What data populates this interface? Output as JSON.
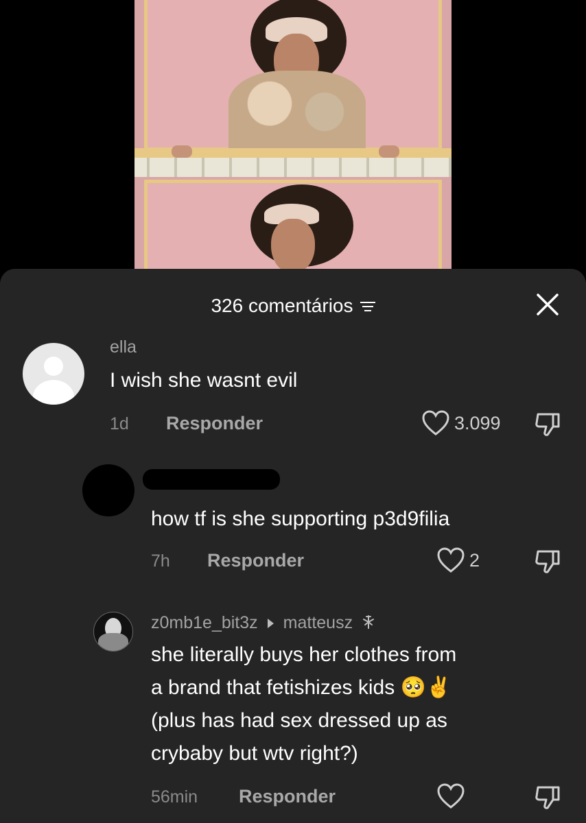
{
  "header": {
    "comment_count_label": "326 comentários"
  },
  "comments": [
    {
      "username": "ella",
      "text": "I wish she wasnt evil",
      "time": "1d",
      "reply_label": "Responder",
      "likes": "3.099"
    },
    {
      "username": "",
      "text": "how tf is she supporting p3d9filia",
      "time": "7h",
      "reply_label": "Responder",
      "likes": "2"
    },
    {
      "username": "z0mb1e_bit3z",
      "reply_to": "matteusz",
      "text_lines": [
        "she literally buys her clothes from",
        "a brand that fetishizes kids 🥺✌️",
        "(plus has had sex dressed up as",
        "crybaby but wtv right?)"
      ],
      "time": "56min",
      "reply_label": "Responder",
      "likes": ""
    }
  ],
  "icons": {
    "heart": "heart-outline",
    "dislike": "thumbs-down-outline",
    "close": "close-x",
    "filter": "sort-filter-lines"
  },
  "colors": {
    "sheet_bg": "#252525",
    "text_primary": "#ffffff",
    "text_secondary": "#a3a3a3"
  }
}
